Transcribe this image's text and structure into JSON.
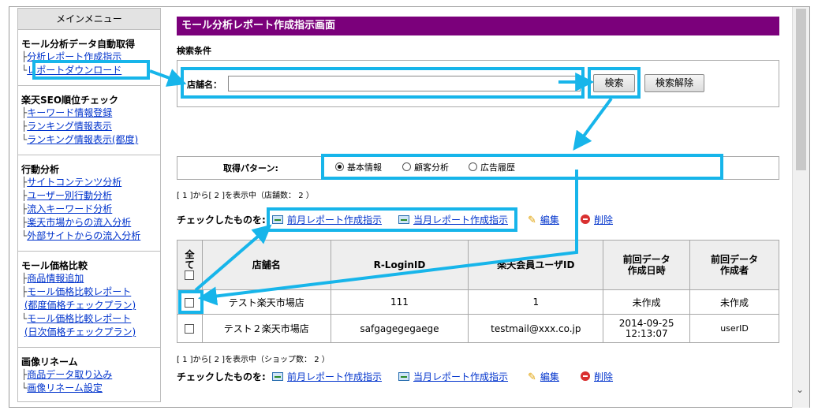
{
  "sidebar": {
    "header": "メインメニュー",
    "sections": [
      {
        "title": "モール分析データ自動取得",
        "items": [
          "分析レポート作成指示",
          "レポートダウンロード"
        ]
      },
      {
        "title": "楽天SEO順位チェック",
        "items": [
          "キーワード情報登録",
          "ランキング情報表示",
          "ランキング情報表示(都度)"
        ]
      },
      {
        "title": "行動分析",
        "items": [
          "サイトコンテンツ分析",
          "ユーザー別行動分析",
          "流入キーワード分析",
          "楽天市場からの流入分析",
          "外部サイトからの流入分析"
        ]
      },
      {
        "title": "モール価格比較",
        "items": [
          "商品情報追加",
          "モール価格比較レポート",
          "(都度価格チェックプラン)",
          "モール価格比較レポート",
          "(日次価格チェックプラン)"
        ]
      },
      {
        "title": "画像リネーム",
        "items": [
          "商品データ取り込み",
          "画像リネーム設定"
        ]
      }
    ]
  },
  "main": {
    "title": "モール分析レポート作成指示画面",
    "search_conditions_label": "検索条件",
    "store_name_label": "店舗名：",
    "store_name_value": "",
    "search_button": "検索",
    "clear_button": "検索解除",
    "pattern_label": "取得パターン:",
    "patterns": [
      {
        "label": "基本情報",
        "selected": true
      },
      {
        "label": "顧客分析",
        "selected": false
      },
      {
        "label": "広告履歴",
        "selected": false
      }
    ],
    "count_text_top": "[ 1 ]から[ 2 ]を表示中（店舗数： 2 ）",
    "count_text_bottom": "[ 1 ]から[ 2 ]を表示中（ショップ数： 2 ）",
    "checked_label": "チェックしたものを:",
    "actions": {
      "prev_report": "前月レポート作成指示",
      "curr_report": "当月レポート作成指示",
      "edit": "編集",
      "delete": "削除"
    },
    "table": {
      "headers": {
        "all": "全\nて",
        "store": "店舗名",
        "login": "R-LoginID",
        "user": "楽天会員ユーザID",
        "date": "前回データ\n作成日時",
        "creator": "前回データ\n作成者"
      },
      "rows": [
        {
          "store": "テスト楽天市場店",
          "login": "111",
          "user": "1",
          "date": "未作成",
          "creator": "未作成"
        },
        {
          "store": "テスト２楽天市場店",
          "login": "safgagegegaege",
          "user": "testmail@xxx.co.jp",
          "date": "2014-09-25\n12:13:07",
          "creator": "userID"
        }
      ]
    }
  },
  "colors": {
    "title_bar": "#7b007b",
    "highlight": "#17b5ea",
    "link": "#0033cc"
  }
}
